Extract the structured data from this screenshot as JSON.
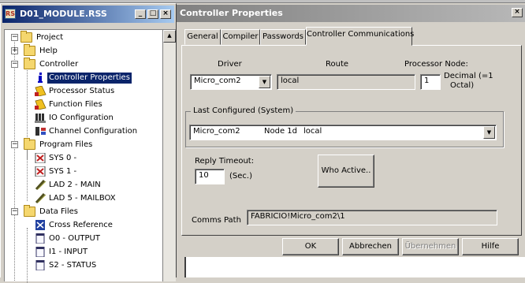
{
  "tree_window": {
    "title": "D01_MODULE.RSS",
    "app_icon": "RS",
    "minimize": "_",
    "restore": "□",
    "close": "×",
    "items": [
      {
        "label": "Project",
        "icon": "folder-icon",
        "level": 0,
        "expander": "−"
      },
      {
        "label": "Help",
        "icon": "folder-icon",
        "level": 1,
        "expander": "+"
      },
      {
        "label": "Controller",
        "icon": "folder-icon",
        "level": 1,
        "expander": "−"
      },
      {
        "label": "Controller Properties",
        "icon": "info-icon",
        "level": 2,
        "selected": true
      },
      {
        "label": "Processor Status",
        "icon": "processor-status-icon",
        "level": 2
      },
      {
        "label": "Function Files",
        "icon": "function-files-icon",
        "level": 2
      },
      {
        "label": "IO Configuration",
        "icon": "io-configuration-icon",
        "level": 2
      },
      {
        "label": "Channel Configuration",
        "icon": "channel-configuration-icon",
        "level": 2
      },
      {
        "label": "Program Files",
        "icon": "folder-icon",
        "level": 1,
        "expander": "−"
      },
      {
        "label": "SYS 0 -",
        "icon": "sys-file-icon",
        "level": 2
      },
      {
        "label": "SYS 1 -",
        "icon": "sys-file-icon",
        "level": 2
      },
      {
        "label": "LAD 2 - MAIN",
        "icon": "ladder-file-icon",
        "level": 2
      },
      {
        "label": "LAD 5 - MAILBOX",
        "icon": "ladder-file-icon",
        "level": 2
      },
      {
        "label": "Data Files",
        "icon": "folder-icon",
        "level": 1,
        "expander": "−"
      },
      {
        "label": "Cross Reference",
        "icon": "cross-reference-icon",
        "level": 2
      },
      {
        "label": "O0 - OUTPUT",
        "icon": "data-file-icon",
        "level": 2
      },
      {
        "label": "I1 - INPUT",
        "icon": "data-file-icon",
        "level": 2
      },
      {
        "label": "S2 - STATUS",
        "icon": "data-file-icon",
        "level": 2
      }
    ]
  },
  "dialog": {
    "title": "Controller Properties",
    "close": "×",
    "tabs": [
      {
        "label": "General"
      },
      {
        "label": "Compiler"
      },
      {
        "label": "Passwords"
      },
      {
        "label": "Controller Communications",
        "active": true
      }
    ],
    "driver_label": "Driver",
    "driver_value": "Micro_com2",
    "route_label": "Route",
    "route_value": "local",
    "processor_node_label": "Processor Node:",
    "processor_node_value": "1",
    "decimal_note_line1": "Decimal (=1",
    "decimal_note_line2": "Octal)",
    "last_configured_label": "Last Configured (System)",
    "last_configured": {
      "driver": "Micro_com2",
      "node": "Node 1d",
      "route": "local"
    },
    "reply_timeout_label": "Reply Timeout:",
    "reply_timeout_value": "10",
    "reply_timeout_unit": "(Sec.)",
    "who_active_label": "Who Active..",
    "comms_path_label": "Comms Path",
    "comms_path_value": "FABRICIO!Micro_com2\\1",
    "buttons": {
      "ok": "OK",
      "cancel": "Abbrechen",
      "apply": "Übernehmen",
      "help": "Hilfe"
    }
  },
  "colors": {
    "active_title": "#0a246a",
    "inactive_title": "#808080",
    "face": "#d4d0c8",
    "selection": "#0a246a"
  }
}
